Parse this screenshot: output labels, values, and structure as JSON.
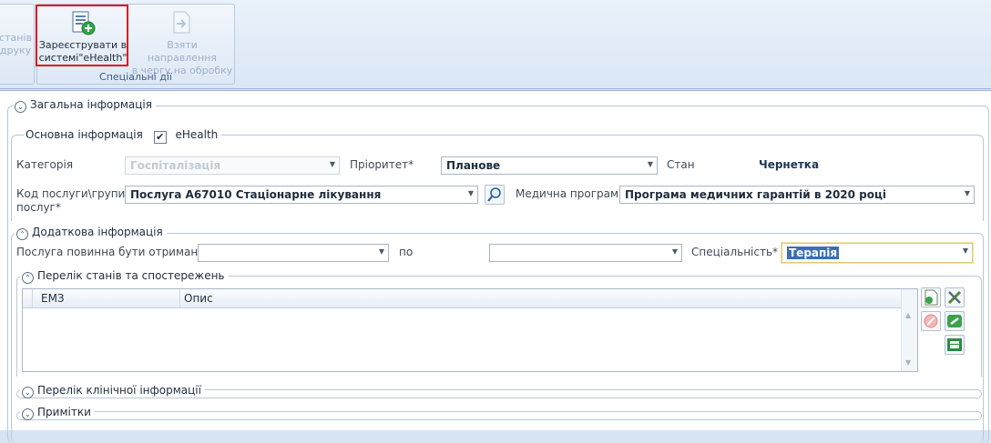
{
  "ribbon": {
    "left_btn_line1": "станів",
    "left_btn_line2": "друку",
    "register_line1": "Зареєструвати в",
    "register_line2": "системі\"eHealth\"",
    "take_line1": "Взяти направлення",
    "take_line2": "в чергу на обробку",
    "group_label": "Спеціальні дії"
  },
  "sections": {
    "general": "Загальна інформація",
    "main_info": "Основна інформація",
    "ehealth_label": "eHealth",
    "ehealth_checked": true,
    "additional": "Додаткова інформація",
    "states": "Перелік станів та спостережень",
    "clinical": "Перелік клінічної інформації",
    "notes": "Примітки"
  },
  "form": {
    "category_label": "Категорія",
    "category_value": "Госпіталізація",
    "priority_label": "Пріоритет*",
    "priority_value": "Планове",
    "state_label": "Стан",
    "state_value": "Чернетка",
    "service_label_1": "Код послуги\\групи",
    "service_label_2": "послуг*",
    "service_value": "Послуга А67010 Стаціонарне лікування",
    "program_label": "Медична програма",
    "program_value": "Програма медичних гарантій в 2020 році",
    "receive_from_label": "Послуга повинна бути отримана з",
    "from_value": "",
    "to_label": "по",
    "to_value": "",
    "specialty_label": "Спеціальність*",
    "specialty_value": "Терапія"
  },
  "grid": {
    "col1": "ЕМЗ",
    "col2": "Опис"
  }
}
